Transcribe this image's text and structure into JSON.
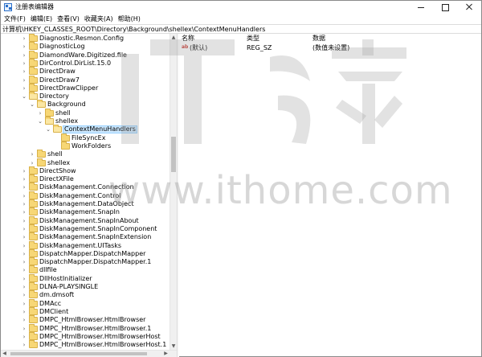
{
  "window": {
    "title": "注册表编辑器"
  },
  "menu": [
    {
      "label": "文件(F)"
    },
    {
      "label": "编辑(E)"
    },
    {
      "label": "查看(V)"
    },
    {
      "label": "收藏夹(A)"
    },
    {
      "label": "帮助(H)"
    }
  ],
  "address": {
    "path": "计算机\\HKEY_CLASSES_ROOT\\Directory\\Background\\shellex\\ContextMenuHandlers"
  },
  "tree": [
    {
      "label": "Diagnostic.Resmon.Config",
      "level": 0,
      "expander": ">"
    },
    {
      "label": "DiagnosticLog",
      "level": 0,
      "expander": ">"
    },
    {
      "label": "DiamondWare.Digitized.file",
      "level": 0,
      "expander": ">"
    },
    {
      "label": "DirControl.DirList.15.0",
      "level": 0,
      "expander": ">"
    },
    {
      "label": "DirectDraw",
      "level": 0,
      "expander": ">"
    },
    {
      "label": "DirectDraw7",
      "level": 0,
      "expander": ">"
    },
    {
      "label": "DirectDrawClipper",
      "level": 0,
      "expander": ">"
    },
    {
      "label": "Directory",
      "level": 0,
      "expander": "v"
    },
    {
      "label": "Background",
      "level": 1,
      "expander": "v"
    },
    {
      "label": "shell",
      "level": 2,
      "expander": ">"
    },
    {
      "label": "shellex",
      "level": 2,
      "expander": "v"
    },
    {
      "label": "ContextMenuHandlers",
      "level": 3,
      "expander": "v",
      "selected": true
    },
    {
      "label": "FileSyncEx",
      "level": 4,
      "expander": ""
    },
    {
      "label": "WorkFolders",
      "level": 4,
      "expander": ""
    },
    {
      "label": "shell",
      "level": 1,
      "expander": ">"
    },
    {
      "label": "shellex",
      "level": 1,
      "expander": ">"
    },
    {
      "label": "DirectShow",
      "level": 0,
      "expander": ">"
    },
    {
      "label": "DirectXFile",
      "level": 0,
      "expander": ">"
    },
    {
      "label": "DiskManagement.Connection",
      "level": 0,
      "expander": ">"
    },
    {
      "label": "DiskManagement.Control",
      "level": 0,
      "expander": ">"
    },
    {
      "label": "DiskManagement.DataObject",
      "level": 0,
      "expander": ">"
    },
    {
      "label": "DiskManagement.SnapIn",
      "level": 0,
      "expander": ">"
    },
    {
      "label": "DiskManagement.SnapInAbout",
      "level": 0,
      "expander": ">"
    },
    {
      "label": "DiskManagement.SnapInComponent",
      "level": 0,
      "expander": ">"
    },
    {
      "label": "DiskManagement.SnapInExtension",
      "level": 0,
      "expander": ">"
    },
    {
      "label": "DiskManagement.UITasks",
      "level": 0,
      "expander": ">"
    },
    {
      "label": "DispatchMapper.DispatchMapper",
      "level": 0,
      "expander": ">"
    },
    {
      "label": "DispatchMapper.DispatchMapper.1",
      "level": 0,
      "expander": ">"
    },
    {
      "label": "dllfile",
      "level": 0,
      "expander": ">"
    },
    {
      "label": "DllHostInitializer",
      "level": 0,
      "expander": ">"
    },
    {
      "label": "DLNA-PLAYSINGLE",
      "level": 0,
      "expander": ">"
    },
    {
      "label": "dm.dmsoft",
      "level": 0,
      "expander": ">"
    },
    {
      "label": "DMAcc",
      "level": 0,
      "expander": ">"
    },
    {
      "label": "DMClient",
      "level": 0,
      "expander": ">"
    },
    {
      "label": "DMPC_HtmlBrowser.HtmlBrowser",
      "level": 0,
      "expander": ">"
    },
    {
      "label": "DMPC_HtmlBrowser.HtmlBrowser.1",
      "level": 0,
      "expander": ">"
    },
    {
      "label": "DMPC_HtmlBrowser.HtmlBrowserHost",
      "level": 0,
      "expander": ">"
    },
    {
      "label": "DMPC_HtmlBrowser.HtmlBrowserHost.1",
      "level": 0,
      "expander": ">"
    }
  ],
  "values": {
    "headers": {
      "name": "名称",
      "type": "类型",
      "data": "数据"
    },
    "rows": [
      {
        "icon": "ab",
        "name": "(默认)",
        "type": "REG_SZ",
        "data": "(数值未设置)"
      }
    ]
  },
  "watermark": {
    "text": "www.ithome.com"
  },
  "colors": {
    "selection": "#cce8ff",
    "folder": "#f7d776",
    "value_icon": "#c8322a"
  }
}
